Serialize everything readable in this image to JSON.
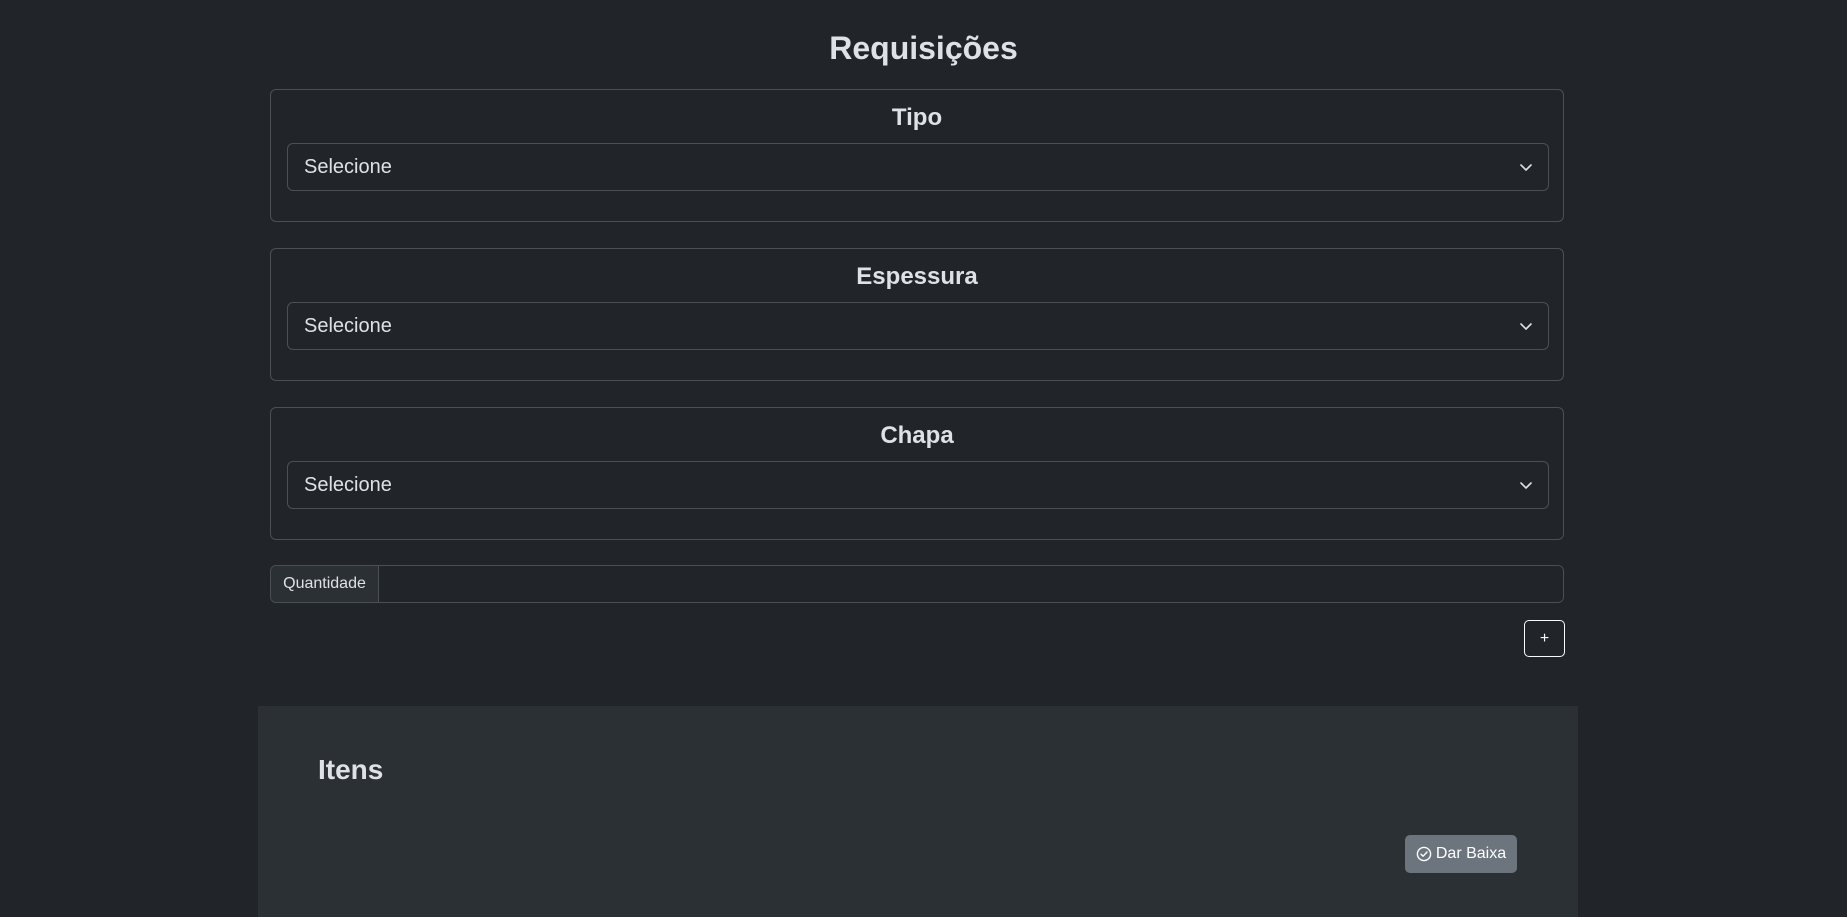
{
  "page": {
    "title": "Requisições"
  },
  "fields": [
    {
      "label": "Tipo",
      "value": "Selecione"
    },
    {
      "label": "Espessura",
      "value": "Selecione"
    },
    {
      "label": "Chapa",
      "value": "Selecione"
    }
  ],
  "quantity": {
    "label": "Quantidade",
    "value": ""
  },
  "add_button": {
    "label": "+"
  },
  "items": {
    "title": "Itens",
    "action_label": "Dar Baixa",
    "action_icon": "check-circle-icon"
  },
  "colors": {
    "background": "#212529",
    "panel": "#2b3035",
    "border": "#495057",
    "secondary_button": "#6c757d",
    "text": "#dee2e6"
  }
}
